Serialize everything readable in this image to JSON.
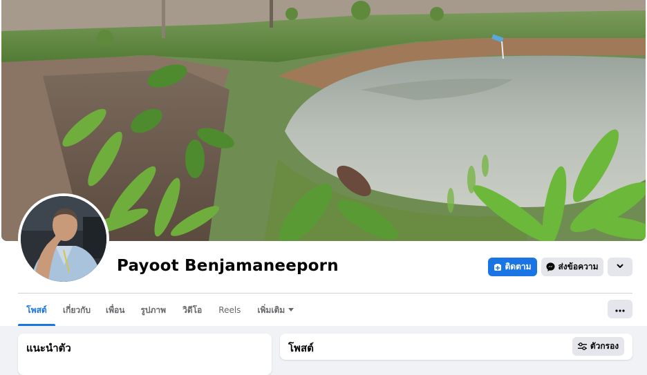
{
  "profile": {
    "name": "Payoot Benjamaneeporn"
  },
  "actions": {
    "follow_label": "ติดตาม",
    "message_label": "ส่งข้อความ"
  },
  "tabs": [
    {
      "label": "โพสต์",
      "active": true
    },
    {
      "label": "เกี่ยวกับ"
    },
    {
      "label": "เพื่อน"
    },
    {
      "label": "รูปภาพ"
    },
    {
      "label": "วิดีโอ"
    },
    {
      "label": "Reels"
    },
    {
      "label": "เพิ่มเติม"
    }
  ],
  "intro": {
    "title": "แนะนำตัว"
  },
  "posts": {
    "title": "โพสต์",
    "filter_label": "ตัวกรอง"
  },
  "colors": {
    "accent": "#1b74e4",
    "secondary_button": "#e4e6eb",
    "page_background": "#f0f2f5"
  },
  "icons": {
    "follow": "user-plus-icon",
    "message": "messenger-icon",
    "more": "chevron-down-icon",
    "tab_more": "ellipsis-icon",
    "filter": "sliders-icon"
  }
}
